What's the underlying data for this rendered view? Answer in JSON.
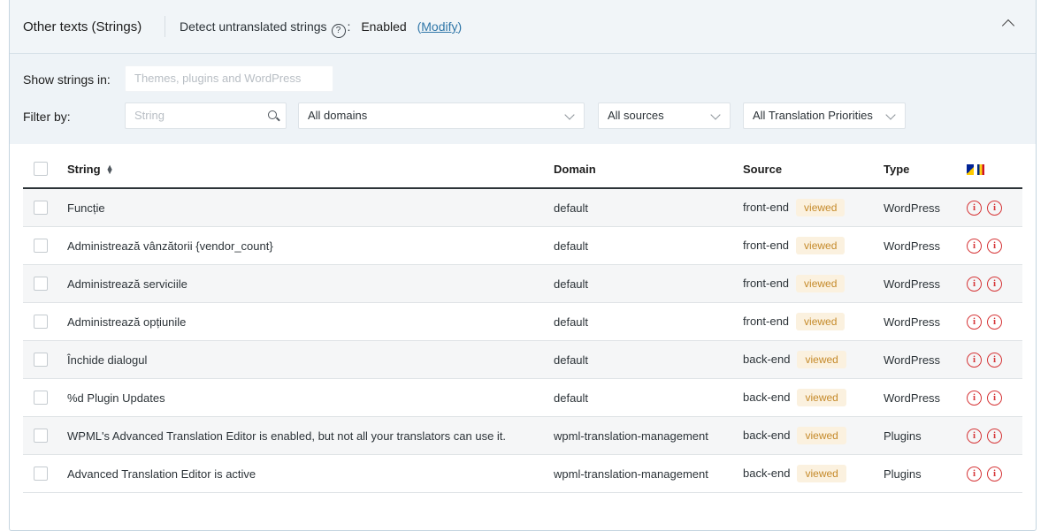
{
  "header": {
    "title": "Other texts (Strings)",
    "detect_label": "Detect untranslated strings",
    "colon": ":",
    "status": "Enabled",
    "paren_open": "(",
    "modify_link": "Modify",
    "paren_close": ")"
  },
  "filters": {
    "show_label": "Show strings in:",
    "show_placeholder": "Themes, plugins and WordPress",
    "filter_label": "Filter by:",
    "search_placeholder": "String",
    "domains_value": "All domains",
    "sources_value": "All sources",
    "priorities_value": "All Translation Priorities"
  },
  "table": {
    "headers": {
      "string": "String",
      "domain": "Domain",
      "source": "Source",
      "type": "Type"
    },
    "languages": [
      "bs",
      "ro"
    ],
    "rows": [
      {
        "string": "Funcție",
        "domain": "default",
        "source": "front-end",
        "badge": "viewed",
        "type": "WordPress"
      },
      {
        "string": "Administrează vânzătorii {vendor_count}",
        "domain": "default",
        "source": "front-end",
        "badge": "viewed",
        "type": "WordPress"
      },
      {
        "string": "Administrează serviciile",
        "domain": "default",
        "source": "front-end",
        "badge": "viewed",
        "type": "WordPress"
      },
      {
        "string": "Administrează opțiunile",
        "domain": "default",
        "source": "front-end",
        "badge": "viewed",
        "type": "WordPress"
      },
      {
        "string": "Închide dialogul",
        "domain": "default",
        "source": "back-end",
        "badge": "viewed",
        "type": "WordPress"
      },
      {
        "string": "%d Plugin Updates",
        "domain": "default",
        "source": "back-end",
        "badge": "viewed",
        "type": "WordPress"
      },
      {
        "string": "WPML's Advanced Translation Editor is enabled, but not all your translators can use it.",
        "domain": "wpml-translation-management",
        "source": "back-end",
        "badge": "viewed",
        "type": "Plugins"
      },
      {
        "string": "Advanced Translation Editor is active",
        "domain": "wpml-translation-management",
        "source": "back-end",
        "badge": "viewed",
        "type": "Plugins"
      }
    ]
  },
  "colors": {
    "accent_link": "#2f76a8",
    "status_icon": "#d63638",
    "badge_bg": "#fbf1df",
    "badge_text": "#c58a2a"
  }
}
